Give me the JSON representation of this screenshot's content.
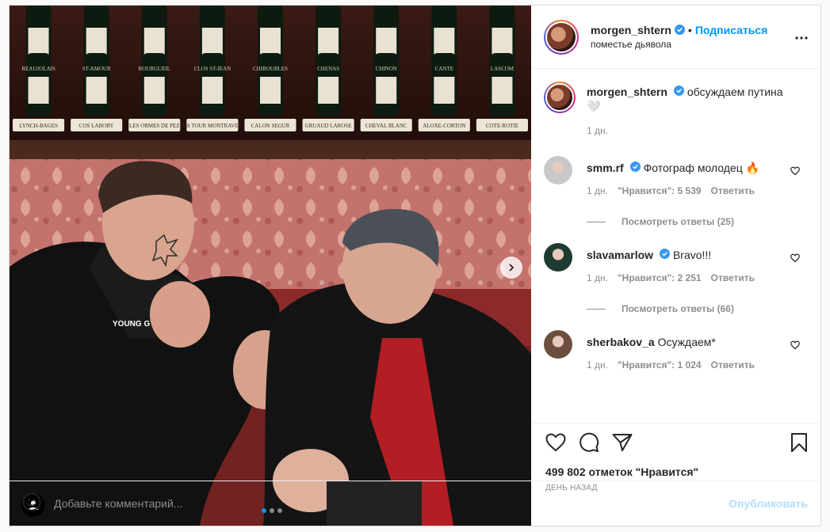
{
  "post": {
    "author": "morgen_shtern",
    "follow_label": "Подписаться",
    "separator": "•",
    "location": "поместье дьявола",
    "caption_user": "morgen_shtern",
    "caption_text": "обсуждаем путина",
    "caption_extra": "🤍",
    "caption_time": "1 дн.",
    "likes": "499 802 отметок \"Нравится\"",
    "date": "ДЕНЬ НАЗАД"
  },
  "photo": {
    "wine_labels": [
      "LYNCH-BAGES",
      "COS LABORY",
      "LES ORMES DE PEZ",
      "LA TOUR MONTRAVEL",
      "CALON SEGUR",
      "GRUAUD LAROSE",
      "CHEVAL BLANC",
      "ALOXE-CORTON",
      "COTE-ROTIE"
    ],
    "upper_labels": [
      "REAUJOLAIS",
      "ST-AMOUR",
      "BOURGUEIL",
      "CLOS ST-JEAN",
      "CHIROUBLES",
      "CHENAS",
      "CHINON",
      "CANTE",
      "LASCOM"
    ],
    "shirt_text": "YOUNG G",
    "slide_count": 3,
    "active_slide": 0
  },
  "comments": [
    {
      "user": "smm.rf",
      "verified": true,
      "text": "Фотограф молодец 🔥",
      "time": "1 дн.",
      "likes": "\"Нравится\": 5 539",
      "reply": "Ответить",
      "view_replies": "Посмотреть ответы (25)",
      "avatar_color": "#c8c8c8"
    },
    {
      "user": "slavamarlow",
      "verified": true,
      "text": "Bravo!!!",
      "time": "1 дн.",
      "likes": "\"Нравится\": 2 251",
      "reply": "Ответить",
      "view_replies": "Посмотреть ответы (66)",
      "avatar_color": "#1d3b2e"
    },
    {
      "user": "sherbakov_a",
      "verified": false,
      "text": "Осуждаем*",
      "time": "1 дн.",
      "likes": "\"Нравится\": 1 024",
      "reply": "Ответить",
      "view_replies": "",
      "avatar_color": "#6b4e3d"
    }
  ],
  "add_comment": {
    "placeholder": "Добавьте комментарий...",
    "publish_label": "Опубликовать"
  },
  "colors": {
    "accent": "#0095f6",
    "publish_disabled": "#b2dffc",
    "muted": "#8e8e8e"
  },
  "icons": [
    "chevron-right-icon",
    "user-tag-icon",
    "verified-icon",
    "more-icon",
    "heart-icon",
    "comment-icon",
    "share-icon",
    "bookmark-icon",
    "emoji-icon"
  ]
}
